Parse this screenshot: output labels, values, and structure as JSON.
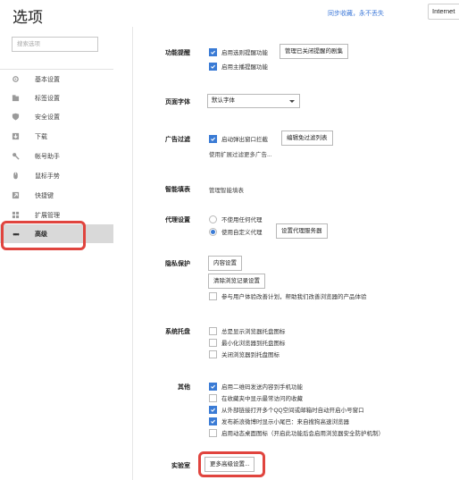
{
  "header": {
    "title": "选项",
    "sync_link": "同步收藏，永不丢失",
    "tab_label": "Internet"
  },
  "search": {
    "placeholder": "搜索选项"
  },
  "sidebar": {
    "items": [
      {
        "label": "基本设置",
        "icon": "gear-icon"
      },
      {
        "label": "标签设置",
        "icon": "tab-icon"
      },
      {
        "label": "安全设置",
        "icon": "shield-icon"
      },
      {
        "label": "下载",
        "icon": "download-icon"
      },
      {
        "label": "帐号助手",
        "icon": "key-icon"
      },
      {
        "label": "鼠标手势",
        "icon": "mouse-icon"
      },
      {
        "label": "快捷键",
        "icon": "shortcut-icon"
      },
      {
        "label": "扩展管理",
        "icon": "extension-icon"
      },
      {
        "label": "高级",
        "icon": "dots-icon",
        "active": true
      }
    ]
  },
  "sections": {
    "features": {
      "label": "功能提醒",
      "opt1": "启用选则提醒功能",
      "opt1_checked": true,
      "manage_button": "管理已关闭提醒的剧集",
      "opt2": "启用主播提醒功能",
      "opt2_checked": true
    },
    "font": {
      "label": "页面字体",
      "value": "默认字体"
    },
    "adfilter": {
      "label": "广告过滤",
      "opt1": "启动弹出窗口拦截",
      "opt1_checked": true,
      "edit_button": "编辑免过滤列表",
      "note": "使用扩展过滤更多广告..."
    },
    "smartfill": {
      "label": "智能填表",
      "text": "管理智能填表"
    },
    "proxy": {
      "label": "代理设置",
      "radio1": "不使用任何代理",
      "radio1_checked": false,
      "radio2": "使用自定义代理",
      "radio2_checked": true,
      "proxy_button": "设置代理服务器"
    },
    "privacy": {
      "label": "隐私保护",
      "content_button": "内容设置",
      "clear_button": "清除浏览记录设置",
      "opt1": "参与用户体验改善计划，帮助我们改善浏览器的产品体验",
      "opt1_checked": false
    },
    "tray": {
      "label": "系统托盘",
      "opt1": "总是显示浏览器托盘图标",
      "opt1_checked": false,
      "opt2": "最小化浏览器到托盘图标",
      "opt2_checked": false,
      "opt3": "关闭浏览器到托盘图标",
      "opt3_checked": false
    },
    "other": {
      "label": "其他",
      "opt1": "启用二维码发送内容到手机功能",
      "opt1_checked": true,
      "opt2": "在收藏夹中显示最常访问的收藏",
      "opt2_checked": false,
      "opt3": "从外部链接打开多个QQ空间或邮箱时自动开启小号窗口",
      "opt3_checked": true,
      "opt4": "发布新浪微博时显示小尾巴：来自搜狗高速浏览器",
      "opt4_checked": true,
      "opt5": "启用动态桌面图标（开启此功能后会启用浏览器安全防护机制）",
      "opt5_checked": false
    },
    "lab": {
      "label": "实验室",
      "more_button": "更多高级设置..."
    }
  },
  "colors": {
    "accent": "#3a7bd5",
    "highlight": "#e0443e",
    "link": "#3c78d8"
  }
}
